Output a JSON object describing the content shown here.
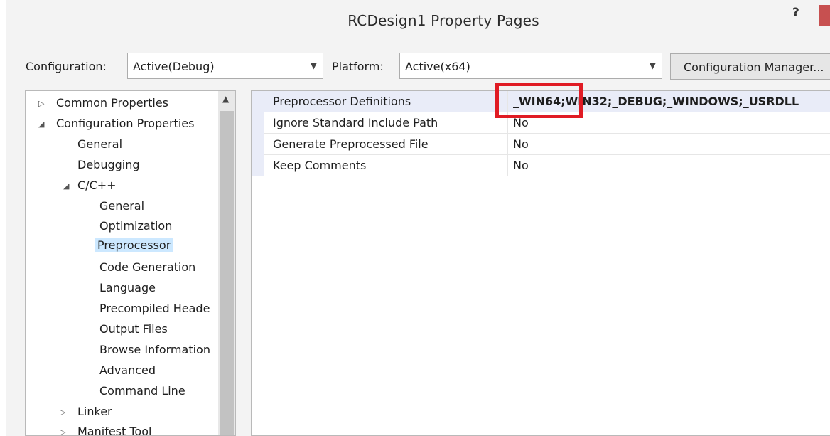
{
  "window": {
    "title": "RCDesign1 Property Pages",
    "help_label": "?"
  },
  "config_row": {
    "configuration_label": "Configuration:",
    "configuration_value": "Active(Debug)",
    "platform_label": "Platform:",
    "platform_value": "Active(x64)",
    "manager_button_label": "Configuration Manager..."
  },
  "tree": {
    "items": [
      {
        "label": "Common Properties",
        "expander": "▷"
      },
      {
        "label": "Configuration Properties",
        "expander": "◢"
      },
      {
        "label": "General"
      },
      {
        "label": "Debugging"
      },
      {
        "label": "C/C++",
        "expander": "◢"
      },
      {
        "label": "General"
      },
      {
        "label": "Optimization"
      },
      {
        "label": "Preprocessor",
        "selected": true
      },
      {
        "label": "Code Generation"
      },
      {
        "label": "Language"
      },
      {
        "label": "Precompiled Heade"
      },
      {
        "label": "Output Files"
      },
      {
        "label": "Browse Information"
      },
      {
        "label": "Advanced"
      },
      {
        "label": "Command Line"
      },
      {
        "label": "Linker",
        "expander": "▷"
      },
      {
        "label": "Manifest Tool",
        "expander": "▷"
      }
    ]
  },
  "properties": [
    {
      "name": "Preprocessor Definitions",
      "value": "_WIN64;WIN32;_DEBUG;_WINDOWS;_USRDLL",
      "selected": true
    },
    {
      "name": "Ignore Standard Include Path",
      "value": "No"
    },
    {
      "name": "Generate Preprocessed File",
      "value": "No"
    },
    {
      "name": "Keep Comments",
      "value": "No"
    }
  ],
  "colors": {
    "highlight_box": "#e01b24",
    "selection": "#cce8ff"
  }
}
